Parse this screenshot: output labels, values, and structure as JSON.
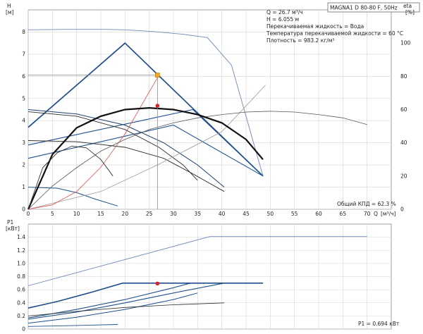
{
  "chart_data": [
    {
      "type": "line",
      "title": "MAGNA1 D 80-80 F, 50Hz",
      "ylabel_left": "H",
      "ylabel_left_unit": "[м]",
      "ylabel_right": "eta",
      "ylabel_right_unit": "[%]",
      "xlabel": "Q",
      "xlabel_unit": "[м³/ч]",
      "xlim": [
        0,
        75
      ],
      "ylim_left": [
        0,
        9
      ],
      "ylim_right": [
        0,
        120
      ],
      "x_ticks": [
        0,
        5,
        10,
        15,
        20,
        25,
        30,
        35,
        40,
        45,
        50,
        55,
        60,
        65,
        70
      ],
      "y_ticks_left": [
        0,
        1,
        2,
        3,
        4,
        5,
        6,
        7,
        8
      ],
      "y_ticks_right": [
        0,
        20,
        40,
        60,
        80,
        100
      ],
      "grid": true,
      "info": {
        "q_line": "Q = 26.7 м³/ч",
        "h_line": "H = 6.055 м",
        "liquid_line": "Перекачиваемая жидкость = Вода",
        "temp_line": "Температура перекачиваемой жидкости = 60 °C",
        "density_line": "Плотность = 983.2 кг/м³"
      },
      "efficiency_label": "Общий КПД = 62.3 %",
      "duty_point": {
        "q": 26.7,
        "h": 6.055
      },
      "efficiency_point": {
        "q": 26.7,
        "eta": 62.3
      },
      "series": [
        {
          "x": [
            0,
            8,
            16,
            20,
            24,
            27,
            32,
            37,
            42,
            48.5
          ],
          "y": [
            8.1,
            8.12,
            8.12,
            8.1,
            8.05,
            8.0,
            7.9,
            7.75,
            6.5,
            1.5
          ]
        },
        {
          "x": [
            0,
            20,
            48.5
          ],
          "y": [
            3.7,
            7.5,
            1.5
          ]
        },
        {
          "x": [
            0,
            34,
            48.5
          ],
          "y": [
            2.9,
            4.5,
            1.5
          ]
        },
        {
          "x": [
            0,
            30,
            48.5
          ],
          "y": [
            2.3,
            3.8,
            1.5
          ]
        },
        {
          "x": [
            0,
            10,
            20,
            28,
            35,
            40.5
          ],
          "y": [
            4.5,
            4.3,
            3.8,
            3.0,
            2.0,
            1.0
          ]
        },
        {
          "x": [
            0,
            10,
            20,
            27,
            32,
            35
          ],
          "y": [
            4.4,
            4.2,
            3.6,
            2.8,
            2.0,
            1.3
          ]
        },
        {
          "x": [
            0,
            10,
            20,
            28,
            34,
            40.5
          ],
          "y": [
            3.1,
            3.05,
            2.8,
            2.3,
            1.6,
            0.8
          ]
        },
        {
          "x": [
            0,
            6,
            10,
            14,
            18.5
          ],
          "y": [
            1.0,
            0.95,
            0.75,
            0.45,
            0.15
          ]
        },
        {
          "x": [
            0,
            15,
            26.7,
            40,
            49
          ],
          "y": [
            0,
            0.8,
            2.0,
            3.5,
            5.6
          ]
        },
        {
          "x": [
            0,
            5,
            10,
            15,
            20,
            25,
            27
          ],
          "y": [
            0,
            0.2,
            0.8,
            1.9,
            3.4,
            5.3,
            6.05
          ]
        }
      ],
      "efficiency_series": [
        {
          "x": [
            0,
            5,
            10,
            15,
            20,
            25,
            30,
            35,
            40,
            45,
            50,
            55,
            60,
            65,
            70
          ],
          "y": [
            0,
            14,
            25,
            35,
            42,
            48,
            52,
            55,
            57,
            58.5,
            59,
            58.5,
            57,
            55,
            51
          ]
        },
        {
          "x": [
            0,
            5,
            10,
            15,
            20,
            25,
            30,
            35,
            40,
            45,
            48.5
          ],
          "y": [
            0,
            33,
            49,
            56,
            60,
            61,
            60,
            57,
            52,
            42,
            30
          ]
        },
        {
          "x": [
            0,
            3,
            6,
            9,
            12,
            15,
            17.5
          ],
          "y": [
            0,
            25,
            34,
            38,
            37,
            30,
            20
          ]
        }
      ]
    },
    {
      "type": "line",
      "ylabel": "P1",
      "ylabel_unit": "[кВт]",
      "xlim": [
        0,
        75
      ],
      "ylim": [
        0,
        1.6
      ],
      "y_ticks": [
        0,
        0.2,
        0.4,
        0.6,
        0.8,
        1.0,
        1.2,
        1.4
      ],
      "grid": true,
      "p1_label": "P1 = 0.694 кВт",
      "duty_point": {
        "q": 26.7,
        "p": 0.694
      },
      "series": [
        {
          "x": [
            0,
            10,
            20,
            30,
            37.5,
            70
          ],
          "y": [
            0.66,
            0.86,
            1.06,
            1.26,
            1.41,
            1.41
          ]
        },
        {
          "x": [
            0,
            6,
            13,
            19.5,
            48.5
          ],
          "y": [
            0.32,
            0.42,
            0.56,
            0.7,
            0.7
          ]
        },
        {
          "x": [
            0,
            10,
            20,
            30,
            33.5,
            48.5
          ],
          "y": [
            0.17,
            0.3,
            0.45,
            0.63,
            0.7,
            0.7
          ]
        },
        {
          "x": [
            0,
            10,
            20,
            30,
            40.5
          ],
          "y": [
            0.15,
            0.26,
            0.4,
            0.55,
            0.7
          ]
        },
        {
          "x": [
            0,
            10,
            20,
            30,
            35
          ],
          "y": [
            0.09,
            0.18,
            0.3,
            0.45,
            0.55
          ]
        },
        {
          "x": [
            0,
            10,
            20,
            30,
            40.5
          ],
          "y": [
            0.2,
            0.27,
            0.33,
            0.37,
            0.4
          ]
        },
        {
          "x": [
            0,
            10,
            18.5
          ],
          "y": [
            0.04,
            0.055,
            0.07
          ]
        }
      ]
    }
  ]
}
